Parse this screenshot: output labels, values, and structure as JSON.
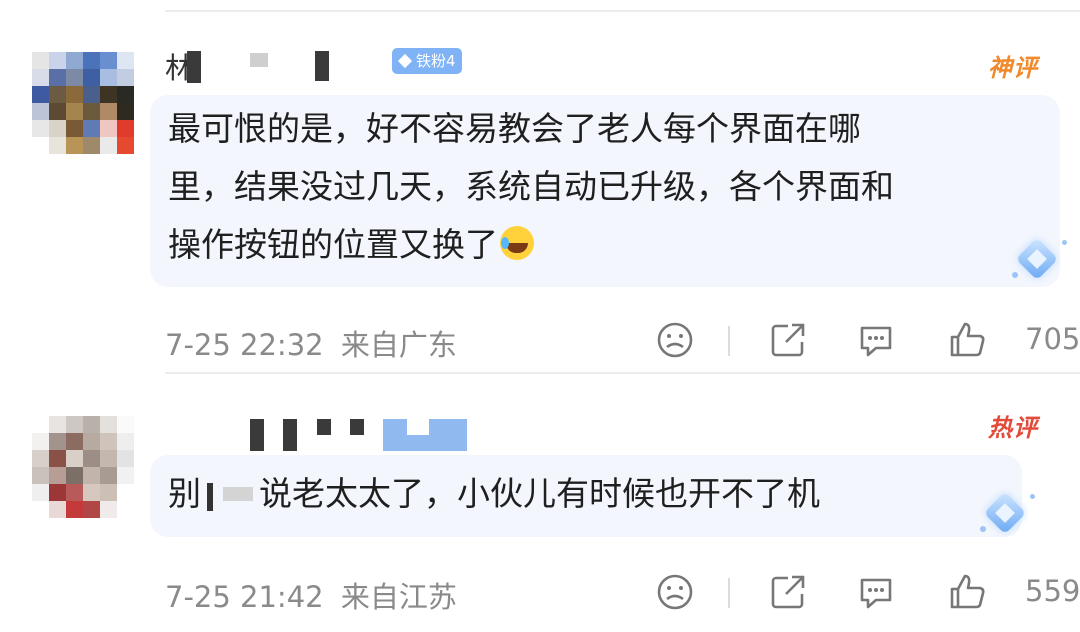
{
  "comments": [
    {
      "name_visible": "林",
      "badge": "铁粉4",
      "tag": "神评",
      "lines": [
        "最可恨的是，好不容易教会了老人每个界面在哪",
        "里，结果没过几天，系统自动已升级，各个界面和",
        "操作按钮的位置又换了"
      ],
      "emoji": "crying-laughing-emoji",
      "time": "7-25 22:32",
      "location": "来自广东",
      "likes": "705"
    },
    {
      "tag": "热评",
      "text_prefix": "别",
      "text_main": "说老太太了，小伙儿有时候也开不了机",
      "time": "7-25 21:42",
      "location": "来自江苏",
      "likes": "559"
    }
  ],
  "colors": {
    "accent_blue": "#7fb3f5",
    "tag_gold": "#f08a2b",
    "tag_red": "#e24a3a",
    "bubble_bg": "#f3f6fd",
    "meta_gray": "#8a8a8a"
  },
  "icons": [
    "dislike-icon",
    "share-icon",
    "comment-icon",
    "like-icon",
    "diamond-decoration-icon"
  ]
}
